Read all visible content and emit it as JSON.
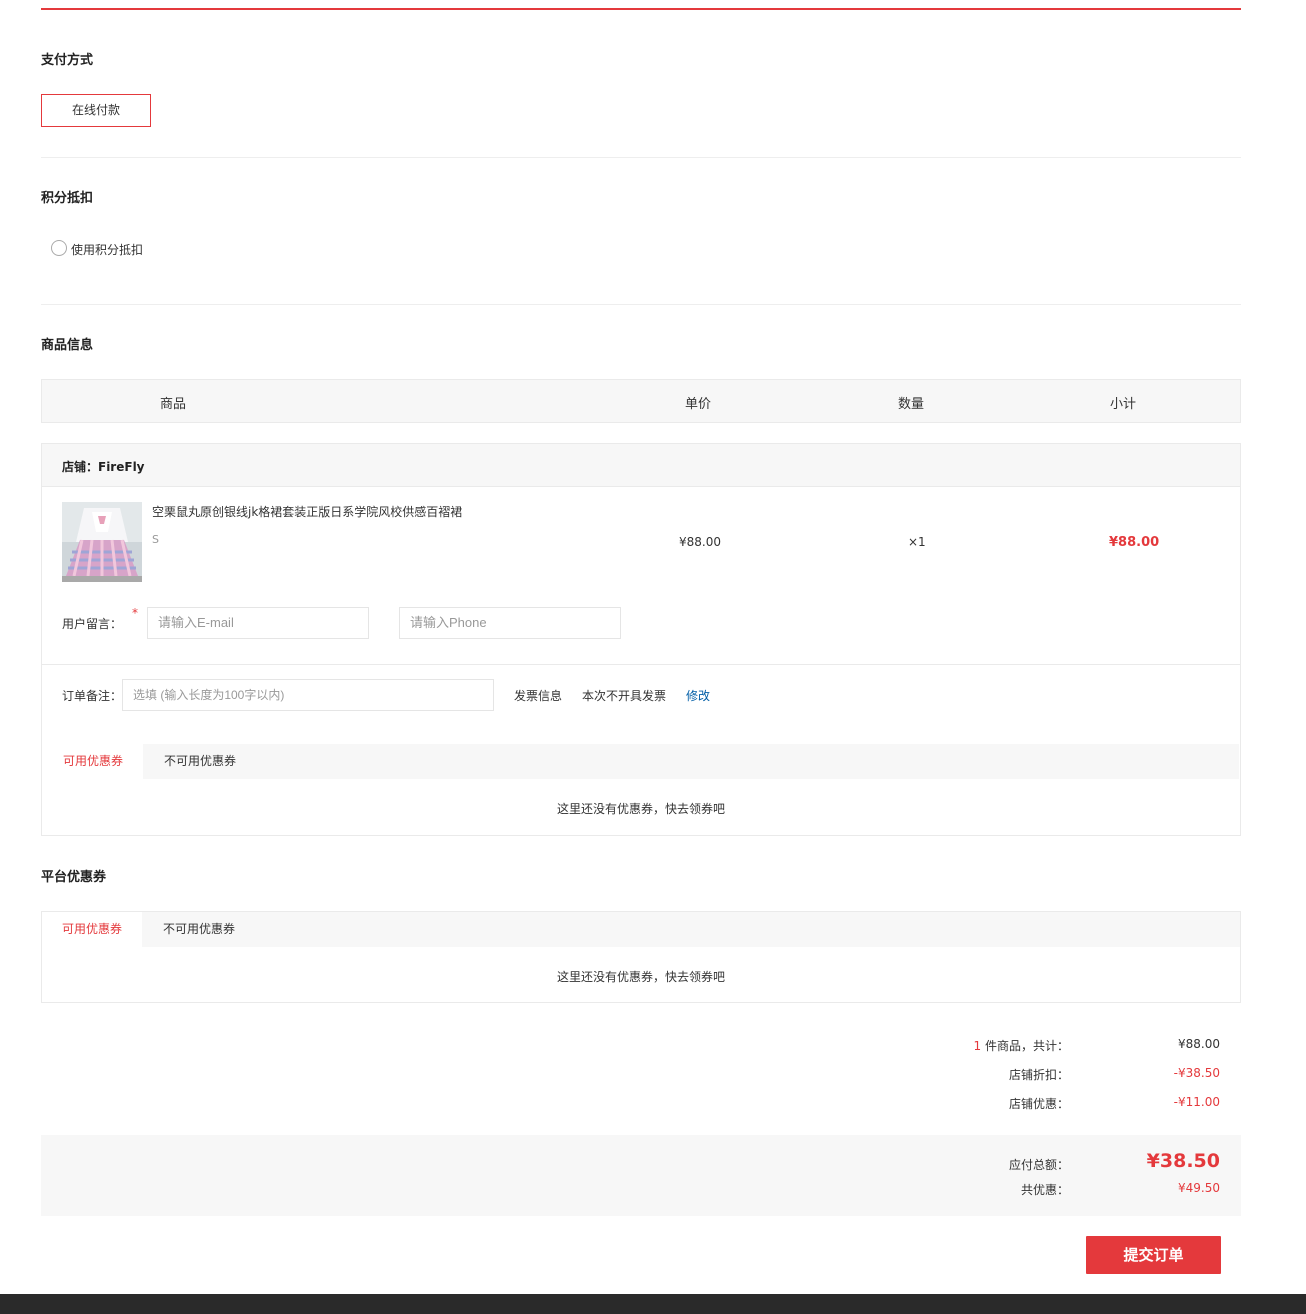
{
  "payment": {
    "title": "支付方式",
    "option_label": "在线付款"
  },
  "points": {
    "title": "积分抵扣",
    "checkbox_label": "使用积分抵扣"
  },
  "goods": {
    "title": "商品信息",
    "columns": [
      "商品",
      "单价",
      "数量",
      "小计"
    ],
    "shop_label": "店铺：FireFly",
    "item": {
      "name": "空栗鼠丸原创银线jk格裙套装正版日系学院风校供感百褶裙",
      "spec": "S",
      "price": "¥88.00",
      "qty": "×1",
      "subtotal": "¥88.00"
    },
    "message_label": "用户留言：",
    "required_mark": "*",
    "email_placeholder": "请输入E-mail",
    "phone_placeholder": "请输入Phone",
    "note_label": "订单备注：",
    "note_placeholder": "选填 (输入长度为100字以内)",
    "invoice_label": "发票信息",
    "invoice_value": "本次不开具发票",
    "invoice_edit": "修改",
    "shop_coupon_tabs": [
      "可用优惠券",
      "不可用优惠券"
    ],
    "shop_coupon_empty": "这里还没有优惠券，快去领券吧"
  },
  "platform_coupon": {
    "title": "平台优惠券",
    "tabs": [
      "可用优惠券",
      "不可用优惠券"
    ],
    "empty": "这里还没有优惠券，快去领券吧"
  },
  "summary": {
    "count": "1",
    "count_suffix": "件商品，共计：",
    "total_value": "¥88.00",
    "shop_discount_label": "店铺折扣：",
    "shop_discount_value": "-¥38.50",
    "shop_coupon_label": "店铺优惠：",
    "shop_coupon_value": "-¥11.00",
    "payable_label": "应付总额：",
    "payable_value": "¥38.50",
    "saved_label": "共优惠：",
    "saved_value": "¥49.50"
  },
  "submit_label": "提交订单",
  "colors": {
    "accent": "#e4393c",
    "link": "#005ea7"
  }
}
